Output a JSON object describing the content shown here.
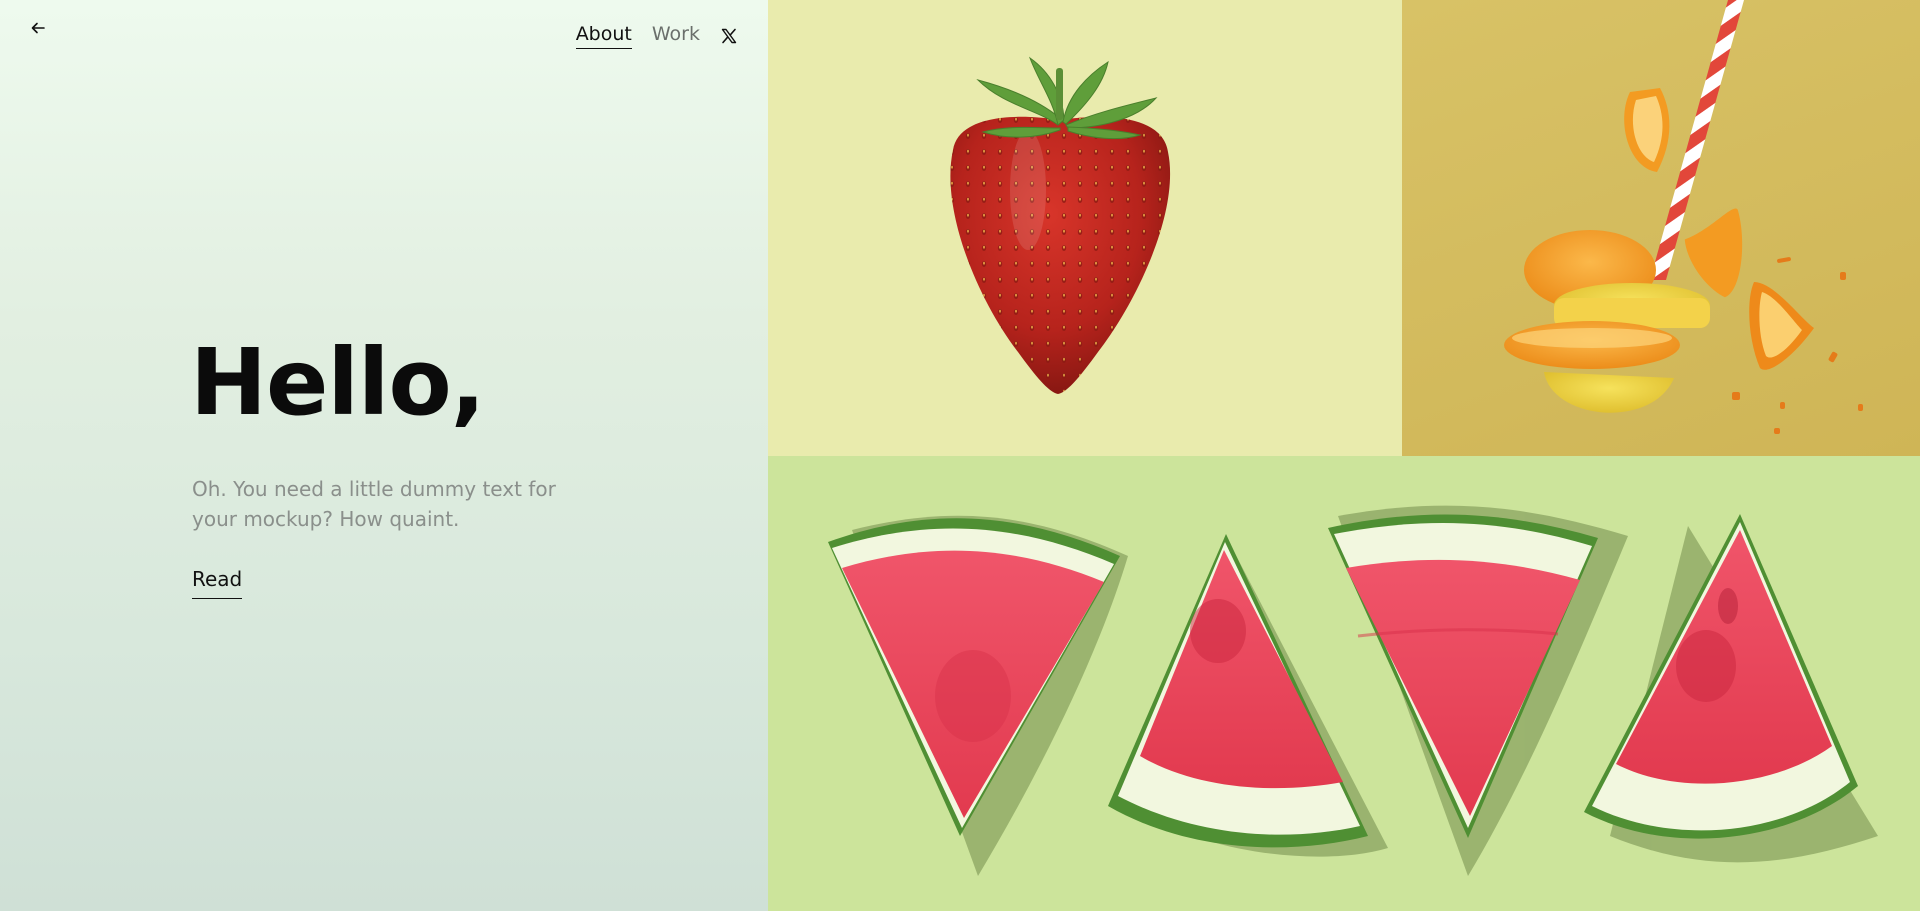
{
  "nav": {
    "back_icon": "arrow-left-icon",
    "links": [
      {
        "label": "About",
        "active": true
      },
      {
        "label": "Work",
        "active": false
      }
    ],
    "social_icon": "x-logo-icon"
  },
  "hero": {
    "title": "Hello,",
    "subtitle": "Oh. You need a little dummy text for your mockup? How quaint.",
    "cta_label": "Read"
  },
  "gallery": {
    "tiles": [
      {
        "name": "strawberry",
        "background": "#e9ebad"
      },
      {
        "name": "orange-drink",
        "background": "#d3bb5c"
      },
      {
        "name": "watermelon-slices",
        "background": "#cce49b"
      }
    ]
  },
  "colors": {
    "text_primary": "#0b0b0b",
    "text_muted": "#8a8f8b"
  }
}
